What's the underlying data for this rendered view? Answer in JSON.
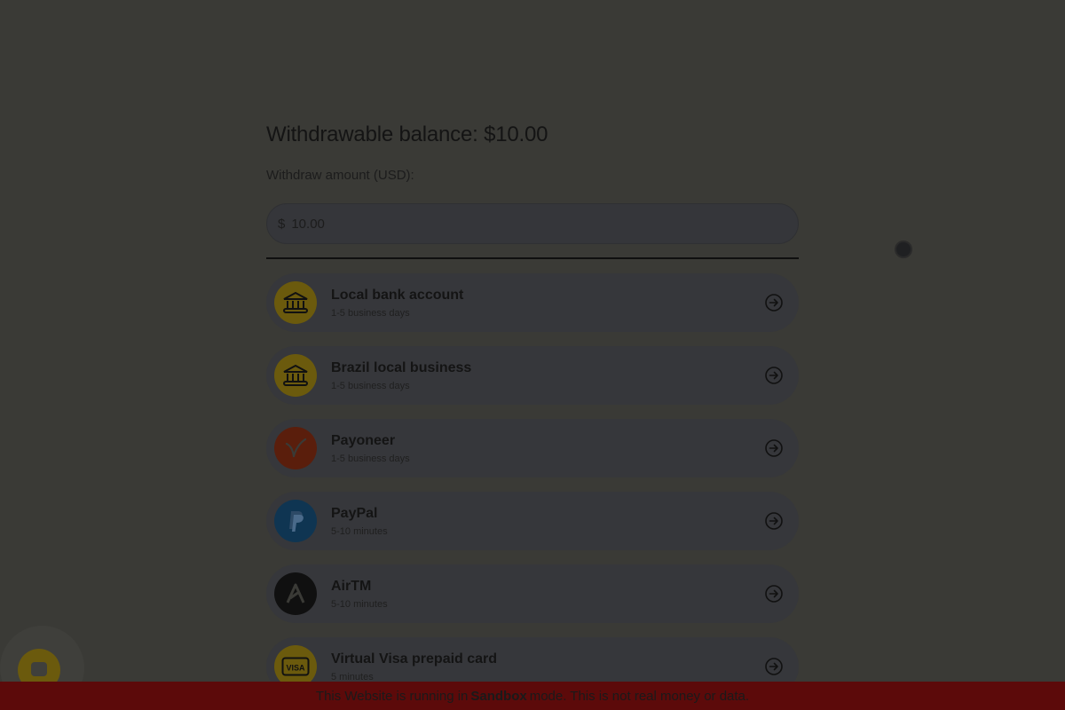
{
  "balance": {
    "title": "Withdrawable balance: $10.00"
  },
  "amount": {
    "label": "Withdraw amount (USD):",
    "currency_symbol": "$",
    "value": "10.00"
  },
  "methods": [
    {
      "name": "Local bank account",
      "time": "1-5 business days",
      "icon": "bank-icon",
      "icon_bg": "#6b5a0d"
    },
    {
      "name": "Brazil local business",
      "time": "1-5 business days",
      "icon": "bank-icon",
      "icon_bg": "#6b5a0d"
    },
    {
      "name": "Payoneer",
      "time": "1-5 business days",
      "icon": "payoneer-logo-icon",
      "icon_bg": "#5a1e0c"
    },
    {
      "name": "PayPal",
      "time": "5-10 minutes",
      "icon": "paypal-logo-icon",
      "icon_bg": "#0f3552"
    },
    {
      "name": "AirTM",
      "time": "5-10 minutes",
      "icon": "airtm-logo-icon",
      "icon_bg": "#101010"
    },
    {
      "name": "Virtual Visa prepaid card",
      "time": "5 minutes",
      "icon": "visa-card-icon",
      "icon_bg": "#6b5a0d"
    }
  ],
  "banner": {
    "prefix": "This Website is running in",
    "mode": "Sandbox",
    "suffix": "mode. This is not real money or data."
  },
  "colors": {
    "overlay_bg": "#3a3a36",
    "accent": "#6b5a0d",
    "banner_bg": "#5c0a0a"
  }
}
